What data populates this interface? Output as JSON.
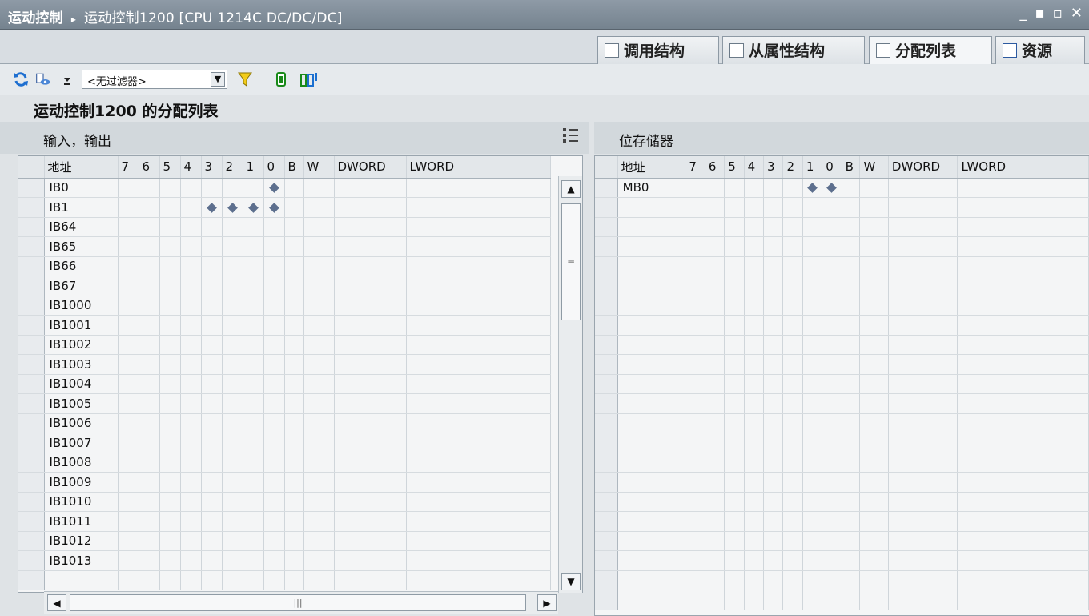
{
  "window": {
    "breadcrumb_root": "运动控制",
    "breadcrumb_sep": "▸",
    "device": "运动控制1200 [CPU 1214C DC/DC/DC]",
    "controls": [
      "_",
      "▪",
      "▫",
      "✕"
    ]
  },
  "tabs": [
    {
      "label": "调用结构",
      "active": false
    },
    {
      "label": "从属性结构",
      "active": false
    },
    {
      "label": "分配列表",
      "active": true
    },
    {
      "label": "资源",
      "active": false
    }
  ],
  "toolbar": {
    "filter_value": "<无过滤器>"
  },
  "heading": "运动控制1200 的分配列表",
  "io_section": {
    "title": "输入，输出",
    "columns": [
      "地址",
      "7",
      "6",
      "5",
      "4",
      "3",
      "2",
      "1",
      "0",
      "B",
      "W",
      "DWORD",
      "LWORD"
    ],
    "rows": [
      {
        "addr": "IB0",
        "bits": [
          "0"
        ]
      },
      {
        "addr": "IB1",
        "bits": [
          "3",
          "2",
          "1",
          "0"
        ]
      },
      {
        "addr": "IB64",
        "bits": []
      },
      {
        "addr": "IB65",
        "bits": []
      },
      {
        "addr": "IB66",
        "bits": []
      },
      {
        "addr": "IB67",
        "bits": []
      },
      {
        "addr": "IB1000",
        "bits": []
      },
      {
        "addr": "IB1001",
        "bits": []
      },
      {
        "addr": "IB1002",
        "bits": []
      },
      {
        "addr": "IB1003",
        "bits": []
      },
      {
        "addr": "IB1004",
        "bits": []
      },
      {
        "addr": "IB1005",
        "bits": []
      },
      {
        "addr": "IB1006",
        "bits": []
      },
      {
        "addr": "IB1007",
        "bits": []
      },
      {
        "addr": "IB1008",
        "bits": []
      },
      {
        "addr": "IB1009",
        "bits": []
      },
      {
        "addr": "IB1010",
        "bits": []
      },
      {
        "addr": "IB1011",
        "bits": []
      },
      {
        "addr": "IB1012",
        "bits": []
      },
      {
        "addr": "IB1013",
        "bits": []
      }
    ]
  },
  "mem_section": {
    "title": "位存储器",
    "columns": [
      "地址",
      "7",
      "6",
      "5",
      "4",
      "3",
      "2",
      "1",
      "0",
      "B",
      "W",
      "DWORD",
      "LWORD"
    ],
    "rows": [
      {
        "addr": "MB0",
        "bits": [
          "1",
          "0"
        ]
      }
    ]
  },
  "colors": {
    "accent": "#75838f",
    "diamond": "#5d6f8e",
    "refresh": "#1e6fd0",
    "filter": "#e0b800"
  }
}
